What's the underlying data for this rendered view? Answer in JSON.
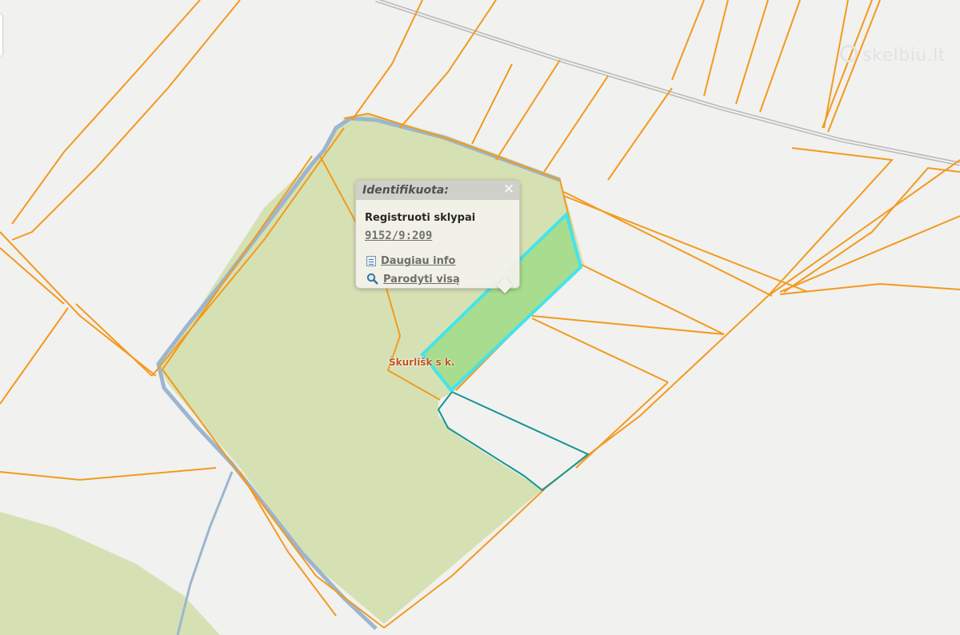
{
  "map": {
    "village_label": "Škurlišk s k.",
    "watermark": "skelbiu.lt",
    "colors": {
      "background": "#f1f1f0",
      "forest_fill": "#d6e1b3",
      "boundary": "#f39a1c",
      "water": "#9bb6ce",
      "selected_parcel": "#44e4ea",
      "selected_fill": "#a8dc8e",
      "neighbour_parcel": "#159494"
    }
  },
  "popup": {
    "title": "Identifikuota:",
    "close_icon": "close-icon",
    "layer_name": "Registruoti sklypai",
    "parcel_number": "9152/9:209",
    "more_info_label": "Daugiau info",
    "show_all_label": "Parodyti visą",
    "more_info_icon": "document-icon",
    "show_all_icon": "magnifier-icon"
  }
}
